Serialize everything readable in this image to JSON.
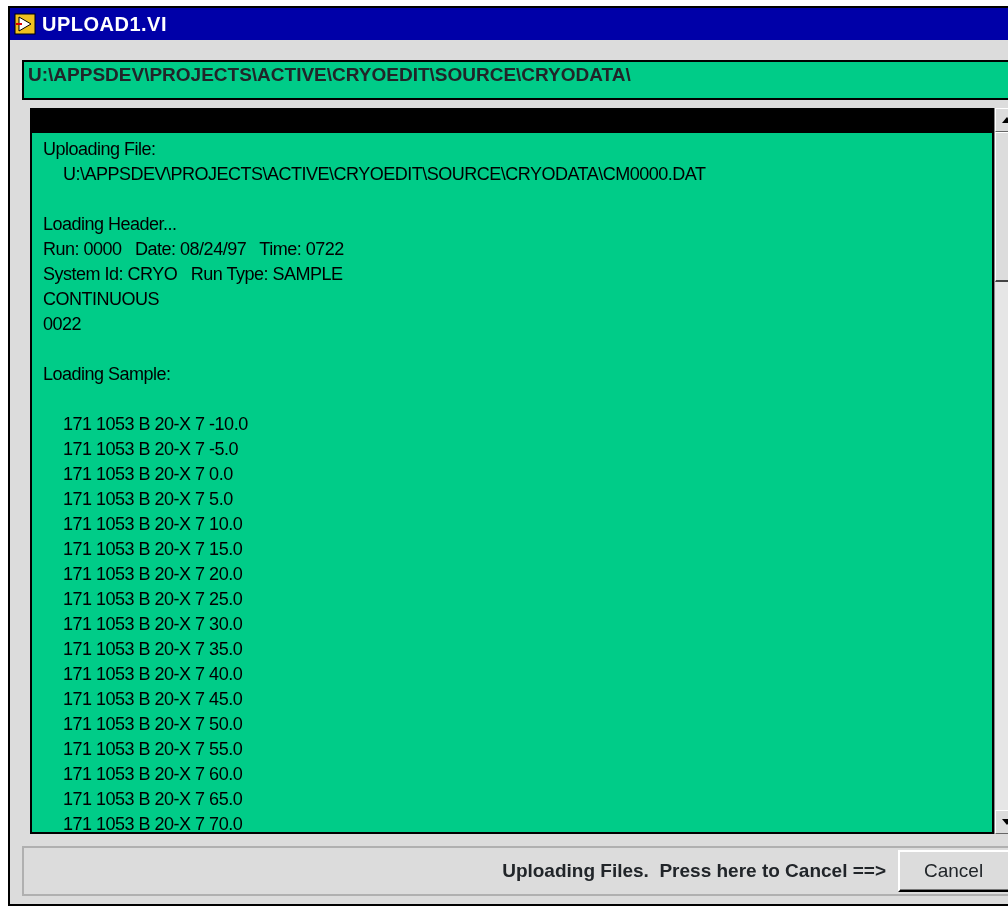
{
  "window": {
    "title": "UPLOAD1.VI"
  },
  "path_field": {
    "value": "U:\\APPSDEV\\PROJECTS\\ACTIVE\\CRYOEDIT\\SOURCE\\CRYODATA\\"
  },
  "log": {
    "blocks": [
      {
        "lines": [
          {
            "text": "Uploading File:",
            "indent": false
          },
          {
            "text": "U:\\APPSDEV\\PROJECTS\\ACTIVE\\CRYOEDIT\\SOURCE\\CRYODATA\\CM0000.DAT",
            "indent": true
          }
        ]
      },
      {
        "lines": [
          {
            "text": "Loading Header...",
            "indent": false
          },
          {
            "text": "Run: 0000   Date: 08/24/97   Time: 0722",
            "indent": false
          },
          {
            "text": "System Id: CRYO   Run Type: SAMPLE",
            "indent": false
          },
          {
            "text": "CONTINUOUS",
            "indent": false
          },
          {
            "text": "0022",
            "indent": false
          }
        ]
      },
      {
        "lines": [
          {
            "text": "Loading Sample:",
            "indent": false
          }
        ]
      },
      {
        "lines": [
          {
            "text": "171 1053 B 20-X 7 -10.0",
            "indent": true
          },
          {
            "text": "171 1053 B 20-X 7 -5.0",
            "indent": true
          },
          {
            "text": "171 1053 B 20-X 7 0.0",
            "indent": true
          },
          {
            "text": "171 1053 B 20-X 7 5.0",
            "indent": true
          },
          {
            "text": "171 1053 B 20-X 7 10.0",
            "indent": true
          },
          {
            "text": "171 1053 B 20-X 7 15.0",
            "indent": true
          },
          {
            "text": "171 1053 B 20-X 7 20.0",
            "indent": true
          },
          {
            "text": "171 1053 B 20-X 7 25.0",
            "indent": true
          },
          {
            "text": "171 1053 B 20-X 7 30.0",
            "indent": true
          },
          {
            "text": "171 1053 B 20-X 7 35.0",
            "indent": true
          },
          {
            "text": "171 1053 B 20-X 7 40.0",
            "indent": true
          },
          {
            "text": "171 1053 B 20-X 7 45.0",
            "indent": true
          },
          {
            "text": "171 1053 B 20-X 7 50.0",
            "indent": true
          },
          {
            "text": "171 1053 B 20-X 7 55.0",
            "indent": true
          },
          {
            "text": "171 1053 B 20-X 7 60.0",
            "indent": true
          },
          {
            "text": "171 1053 B 20-X 7 65.0",
            "indent": true
          },
          {
            "text": "171 1053 B 20-X 7 70.0",
            "indent": true
          }
        ]
      }
    ]
  },
  "footer": {
    "message": "Uploading Files.  Press here to Cancel ==>",
    "button": "Cancel"
  }
}
